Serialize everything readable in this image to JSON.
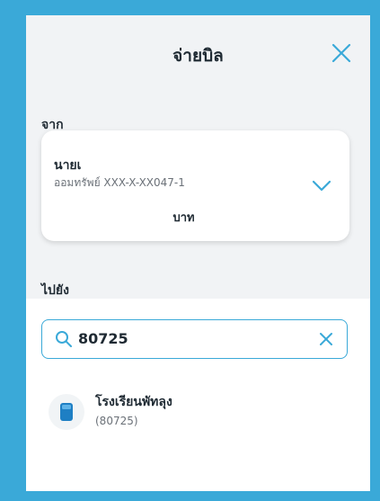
{
  "header": {
    "title": "จ่ายบิล",
    "close_icon": "close-icon"
  },
  "from_section": {
    "label": "จาก",
    "account": {
      "name": "นายเ",
      "type_and_number": "ออมทรัพย์ XXX-X-XX047-1",
      "balance_unit": "บาท",
      "expand_icon": "chevron-down-icon"
    }
  },
  "to_section": {
    "label": "ไปยัง"
  },
  "search": {
    "value": "80725",
    "search_icon": "search-icon",
    "clear_icon": "clear-icon"
  },
  "results": [
    {
      "name": "โรงเรียนพัทลุง",
      "code": "(80725)",
      "icon": "biller-icon"
    }
  ],
  "colors": {
    "accent": "#3aa9d8",
    "frame": "#3aa9d8",
    "background": "#f1f3f5",
    "biller_icon": "#1e7fc4"
  }
}
